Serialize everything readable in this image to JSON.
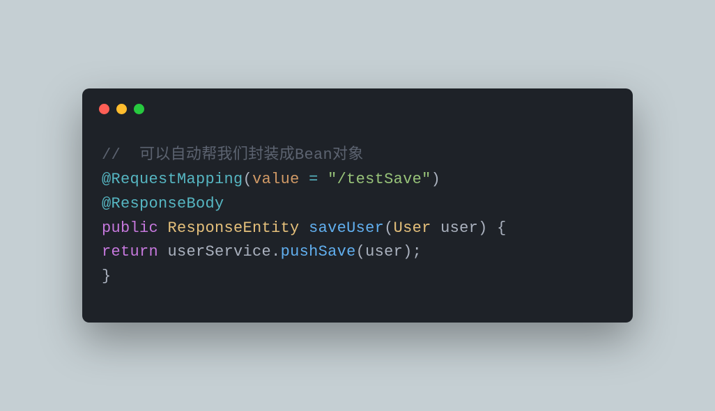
{
  "code": {
    "comment_prefix": "//  ",
    "comment_text": "可以自动帮我们封装成Bean对象",
    "line2": {
      "annotation": "@RequestMapping",
      "open": "(",
      "param": "value",
      "equals": " = ",
      "string": "\"/testSave\"",
      "close": ")"
    },
    "line3": {
      "annotation": "@ResponseBody"
    },
    "line4": {
      "keyword": "public",
      "return_type": " ResponseEntity ",
      "method": "saveUser",
      "open": "(",
      "param_type": "User",
      "param_name": " user",
      "close": ")",
      "brace": " {"
    },
    "line5": {
      "keyword": "return",
      "space": " ",
      "object": "userService",
      "dot": ".",
      "method": "pushSave",
      "open": "(",
      "arg": "user",
      "close": ")",
      "semicolon": ";"
    },
    "line6": {
      "brace": "}"
    }
  }
}
